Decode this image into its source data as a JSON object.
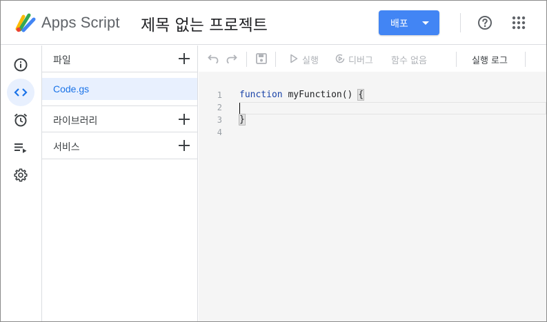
{
  "header": {
    "app_name": "Apps Script",
    "project_title": "제목 없는 프로젝트",
    "deploy_label": "배포"
  },
  "rail": {
    "items": [
      "overview-icon",
      "editor-icon",
      "triggers-icon",
      "executions-icon",
      "settings-icon"
    ],
    "active": "editor-icon"
  },
  "files_panel": {
    "files_label": "파일",
    "file_name": "Code.gs",
    "libraries_label": "라이브러리",
    "services_label": "서비스"
  },
  "toolbar": {
    "run_label": "실행",
    "debug_label": "디버그",
    "function_label": "함수 없음",
    "log_label": "실행 로그"
  },
  "editor": {
    "line_numbers": [
      "1",
      "2",
      "3",
      "4"
    ],
    "code_keyword": "function",
    "code_rest": " myFunction() ",
    "open_brace": "{",
    "close_brace": "}"
  },
  "colors": {
    "accent": "#4285f4",
    "selection": "#e8f0fe",
    "link": "#1a73e8"
  }
}
